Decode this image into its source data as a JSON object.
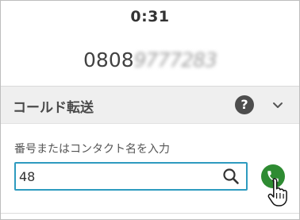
{
  "call": {
    "timer": "0:31",
    "number_visible": "0808",
    "number_masked": "9777283"
  },
  "panel": {
    "title": "コールド転送",
    "help_glyph": "?",
    "field_label": "番号またはコンタクト名を入力",
    "input_value": "48"
  },
  "icons": {
    "help": "help-icon",
    "collapse": "chevron-down-icon",
    "search": "search-icon",
    "call": "phone-icon",
    "cursor": "hand-pointer-icon"
  },
  "colors": {
    "input_focus_border": "#2e9bbf",
    "call_button": "#2e8b32",
    "header_background": "#efefef"
  }
}
